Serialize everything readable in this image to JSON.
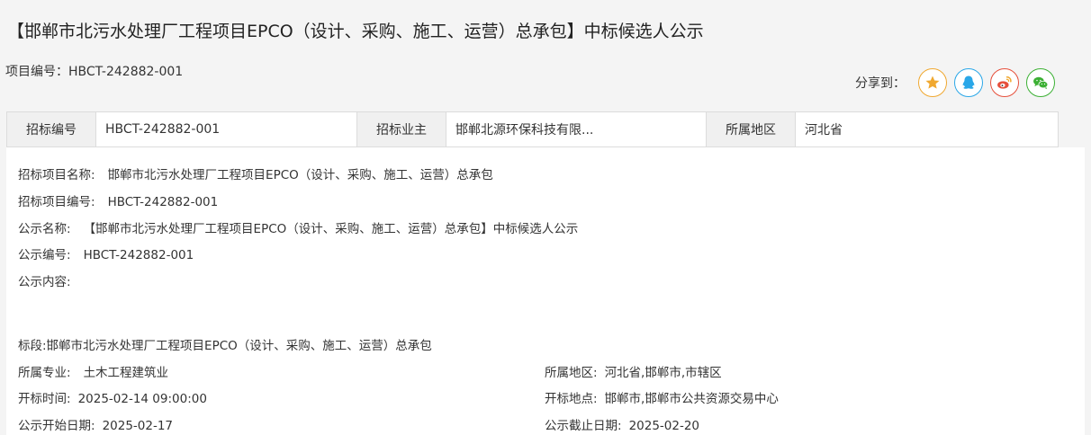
{
  "header": {
    "title": "【邯郸市北污水处理厂工程项目EPCO（设计、采购、施工、运营）总承包】中标候选人公示",
    "project_code": "项目编号：HBCT-242882-001"
  },
  "share": {
    "label": "分享到：",
    "buttons": [
      {
        "name": "qzone",
        "icon": "star-icon",
        "color": "#f0a830"
      },
      {
        "name": "qq",
        "icon": "qq-penguin-icon",
        "color": "#2aa7e8"
      },
      {
        "name": "weibo",
        "icon": "weibo-icon",
        "color": "#e6503c"
      },
      {
        "name": "wechat",
        "icon": "wechat-icon",
        "color": "#3cb034"
      }
    ]
  },
  "info_table": {
    "bid_no_label": "招标编号",
    "bid_no_value": "HBCT-242882-001",
    "owner_label": "招标业主",
    "owner_value": "邯郸北源环保科技有限...",
    "region_label": "所属地区",
    "region_value": "河北省"
  },
  "details": {
    "project_name_label": "招标项目名称:",
    "project_name_value": "邯郸市北污水处理厂工程项目EPCO（设计、采购、施工、运营）总承包",
    "project_code_label": "招标项目编号:",
    "project_code_value": "HBCT-242882-001",
    "notice_name_label": "公示名称:",
    "notice_name_value": "【邯郸市北污水处理厂工程项目EPCO（设计、采购、施工、运营）总承包】中标候选人公示",
    "notice_code_label": "公示编号:",
    "notice_code_value": "HBCT-242882-001",
    "notice_content_label": "公示内容:",
    "section_line": "标段:邯郸市北污水处理厂工程项目EPCO（设计、采购、施工、运营）总承包",
    "specialty_label": "所属专业:",
    "specialty_value": "土木工程建筑业",
    "area_label": "所属地区:",
    "area_value": "河北省,邯郸市,市辖区",
    "open_time_label": "开标时间:",
    "open_time_value": "2025-02-14 09:00:00",
    "open_place_label": "开标地点:",
    "open_place_value": "邯郸市,邯郸市公共资源交易中心",
    "start_date_label": "公示开始日期:",
    "start_date_value": "2025-02-17",
    "end_date_label": "公示截止日期:",
    "end_date_value": "2025-02-20"
  }
}
